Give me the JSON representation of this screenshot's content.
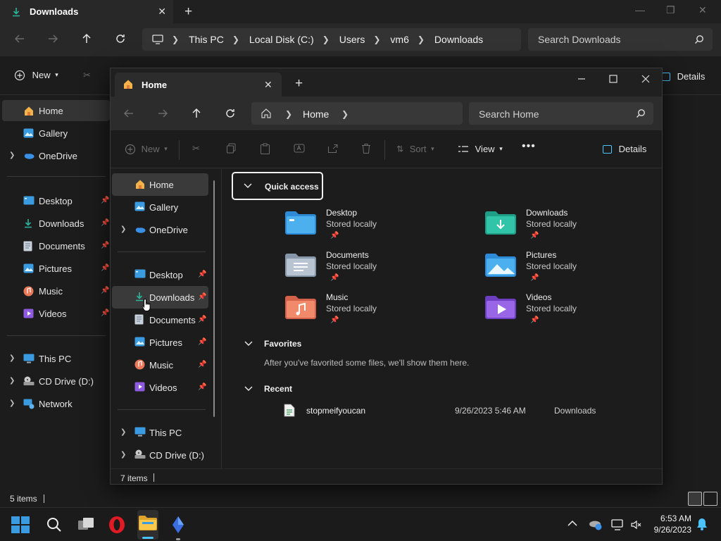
{
  "colors": {
    "accent": "#4cc2ff",
    "selected_bg": "#3a3a3a",
    "window_bg": "#1c1c1c",
    "folder_blue": "#3a9be0",
    "folder_teal": "#2bb59a"
  },
  "bg_window": {
    "tab_title": "Downloads",
    "tab_icon": "download-arrow-icon",
    "breadcrumb": [
      "This PC",
      "Local Disk (C:)",
      "Users",
      "vm6",
      "Downloads"
    ],
    "search_placeholder": "Search Downloads",
    "toolbar": {
      "new_label": "New",
      "details_label": "Details"
    },
    "sidebar": [
      {
        "label": "Home",
        "icon": "home-icon",
        "selected": true
      },
      {
        "label": "Gallery",
        "icon": "gallery-icon"
      },
      {
        "label": "OneDrive",
        "icon": "cloud-icon",
        "expandable": true
      },
      {
        "label": "Desktop",
        "icon": "desktop-folder-icon",
        "pinned": true
      },
      {
        "label": "Downloads",
        "icon": "download-arrow-icon",
        "pinned": true
      },
      {
        "label": "Documents",
        "icon": "document-icon",
        "pinned": true
      },
      {
        "label": "Pictures",
        "icon": "pictures-icon",
        "pinned": true
      },
      {
        "label": "Music",
        "icon": "music-icon",
        "pinned": true
      },
      {
        "label": "Videos",
        "icon": "videos-icon",
        "pinned": true
      },
      {
        "label": "This PC",
        "icon": "monitor-icon",
        "expandable": true
      },
      {
        "label": "CD Drive (D:)",
        "icon": "cd-drive-icon",
        "expandable": true
      },
      {
        "label": "Network",
        "icon": "network-icon",
        "expandable": true
      }
    ],
    "status": "5 items"
  },
  "fg_window": {
    "tab_title": "Home",
    "breadcrumb": [
      "Home"
    ],
    "search_placeholder": "Search Home",
    "toolbar": {
      "new_label": "New",
      "sort_label": "Sort",
      "view_label": "View",
      "more_label": "•••",
      "details_label": "Details"
    },
    "sidebar": [
      {
        "label": "Home",
        "icon": "home-icon",
        "selected": true
      },
      {
        "label": "Gallery",
        "icon": "gallery-icon"
      },
      {
        "label": "OneDrive",
        "icon": "cloud-icon",
        "expandable": true
      },
      {
        "label": "Desktop",
        "icon": "desktop-folder-icon",
        "pinned": true
      },
      {
        "label": "Downloads",
        "icon": "download-arrow-icon",
        "pinned": true,
        "hovered": true
      },
      {
        "label": "Documents",
        "icon": "document-icon",
        "pinned": true
      },
      {
        "label": "Pictures",
        "icon": "pictures-icon",
        "pinned": true
      },
      {
        "label": "Music",
        "icon": "music-icon",
        "pinned": true
      },
      {
        "label": "Videos",
        "icon": "videos-icon",
        "pinned": true
      },
      {
        "label": "This PC",
        "icon": "monitor-icon",
        "expandable": true
      },
      {
        "label": "CD Drive (D:)",
        "icon": "cd-drive-icon",
        "expandable": true
      }
    ],
    "quick_access": {
      "header": "Quick access",
      "items": [
        {
          "name": "Desktop",
          "status": "Stored locally",
          "icon": "desktop-folder-icon"
        },
        {
          "name": "Downloads",
          "status": "Stored locally",
          "icon": "downloads-folder-icon"
        },
        {
          "name": "Documents",
          "status": "Stored locally",
          "icon": "documents-folder-icon"
        },
        {
          "name": "Pictures",
          "status": "Stored locally",
          "icon": "pictures-folder-icon"
        },
        {
          "name": "Music",
          "status": "Stored locally",
          "icon": "music-folder-icon"
        },
        {
          "name": "Videos",
          "status": "Stored locally",
          "icon": "videos-folder-icon"
        }
      ]
    },
    "favorites": {
      "header": "Favorites",
      "empty_text": "After you've favorited some files, we'll show them here."
    },
    "recent": {
      "header": "Recent",
      "items": [
        {
          "name": "stopmeifyoucan",
          "date": "9/26/2023 5:46 AM",
          "location": "Downloads",
          "icon": "file-icon"
        }
      ]
    },
    "status": "7 items"
  },
  "taskbar": {
    "apps": [
      "windows-start-icon",
      "search-icon",
      "task-view-icon",
      "opera-icon",
      "file-explorer-icon",
      "app-icon"
    ],
    "time": "6:53 AM",
    "date": "9/26/2023"
  }
}
